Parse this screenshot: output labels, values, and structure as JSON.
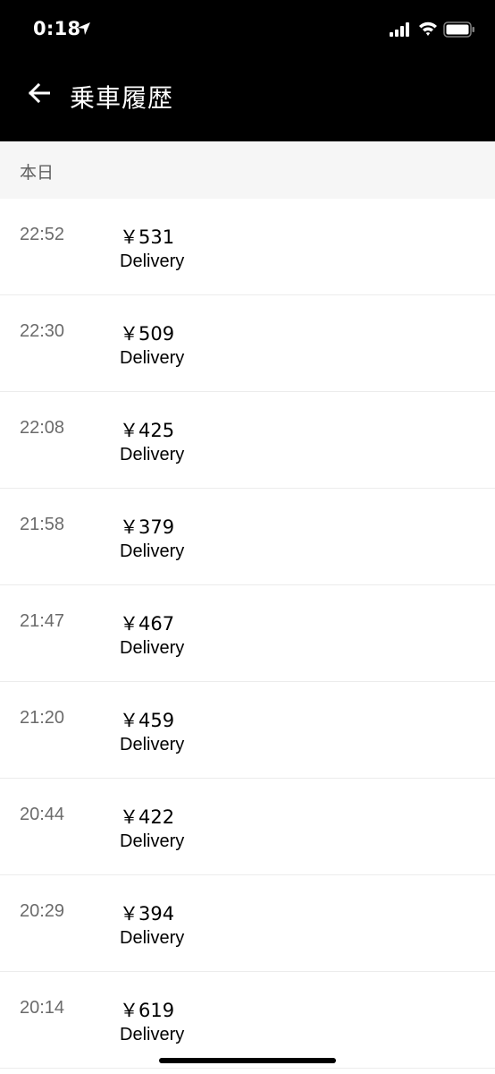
{
  "status_bar": {
    "time": "0:18",
    "icons": [
      "location-arrow-icon",
      "cellular-signal-icon",
      "wifi-icon",
      "battery-icon"
    ]
  },
  "header": {
    "title": "乗車履歴",
    "back_icon": "arrow-left-icon"
  },
  "section": {
    "label": "本日"
  },
  "trips": [
    {
      "time": "22:52",
      "amount": "￥531",
      "service": "Delivery"
    },
    {
      "time": "22:30",
      "amount": "￥509",
      "service": "Delivery"
    },
    {
      "time": "22:08",
      "amount": "￥425",
      "service": "Delivery"
    },
    {
      "time": "21:58",
      "amount": "￥379",
      "service": "Delivery"
    },
    {
      "time": "21:47",
      "amount": "￥467",
      "service": "Delivery"
    },
    {
      "time": "21:20",
      "amount": "￥459",
      "service": "Delivery"
    },
    {
      "time": "20:44",
      "amount": "￥422",
      "service": "Delivery"
    },
    {
      "time": "20:29",
      "amount": "￥394",
      "service": "Delivery"
    },
    {
      "time": "20:14",
      "amount": "￥619",
      "service": "Delivery"
    }
  ],
  "colors": {
    "header_bg": "#000000",
    "section_bg": "#f6f6f6",
    "time_text": "#6b6b6b",
    "divider": "#ececec"
  }
}
